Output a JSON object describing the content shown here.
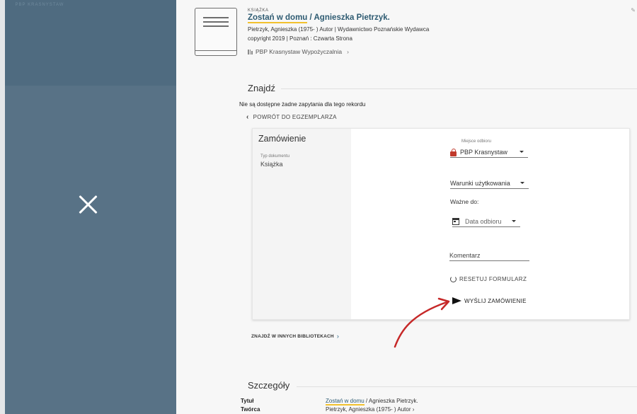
{
  "side_panel": {
    "logo_text": "PBP KRASNYSTAW",
    "close_label": "✕"
  },
  "record": {
    "type": "KSIĄŻKA",
    "title_linked": "Zostań w domu",
    "title_rest": " / Agnieszka Pietrzyk.",
    "meta_line1": "Pietrzyk, Agnieszka (1975- ) Autor | Wydawnictwo Poznańskie Wydawca",
    "meta_line2": "copyright 2019 | Poznań : Czwarta Strona",
    "location": "PBP Krasnystaw  Wypożyczalnia",
    "location_chevron": "›"
  },
  "find": {
    "title": "Znajdź",
    "no_requests": "Nie są dostępne żadne zapytania dla tego rekordu",
    "back_link": "POWRÓT DO EGZEMPLARZA",
    "back_chevron": "‹"
  },
  "order": {
    "title": "Zamówienie",
    "doc_type_label": "Typ dokumentu",
    "doc_type_value": "Książka",
    "pickup_label": "Miejsce odbioru",
    "pickup_value": "PBP Krasnystaw",
    "terms_value": "Warunki użytkowania",
    "valid_until_label": "Ważne do:",
    "date_placeholder": "Data odbioru",
    "comment_placeholder": "Komentarz",
    "reset_label": "RESETUJ FORMULARZ",
    "send_label": "WYŚLIJ ZAMÓWIENIE"
  },
  "other_libraries": {
    "label": "ZNAJDŹ W INNYCH BIBLIOTEKACH",
    "chevron": "›"
  },
  "details": {
    "title": "Szczegóły",
    "rows": [
      {
        "key": "Tytuł",
        "value_link": "Zostań w domu",
        "value_rest": " / Agnieszka Pietrzyk."
      },
      {
        "key": "Twórca",
        "value_link": "",
        "value_rest": "Pietrzyk, Agnieszka (1975- ) Autor  ›"
      }
    ]
  },
  "colors": {
    "panel": "#587286",
    "accent_underline": "#f2c12e",
    "link": "#2e5b72",
    "arrow": "#c62828"
  }
}
